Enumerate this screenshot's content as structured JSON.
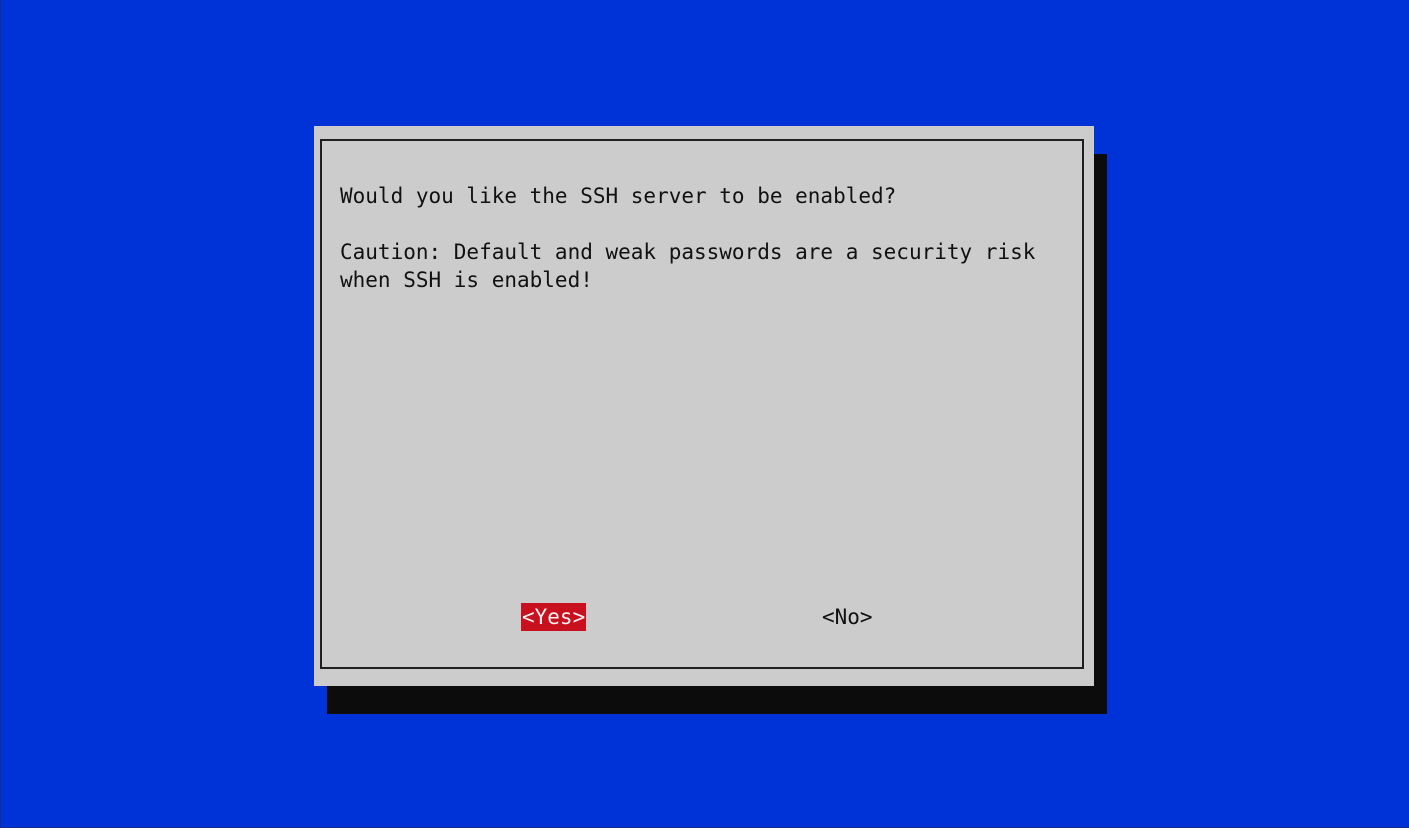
{
  "dialog": {
    "question": "Would you like the SSH server to be enabled?",
    "caution_line_1": "Caution: Default and weak passwords are a security risk",
    "caution_line_2": "when SSH is enabled!"
  },
  "buttons": {
    "yes_label": "<Yes>",
    "no_label": "<No>",
    "selected": "yes"
  },
  "colors": {
    "background": "#0033d7",
    "dialog": "#cccccc",
    "shadow": "#0c0c0c",
    "selected_button": "#c8101f"
  }
}
